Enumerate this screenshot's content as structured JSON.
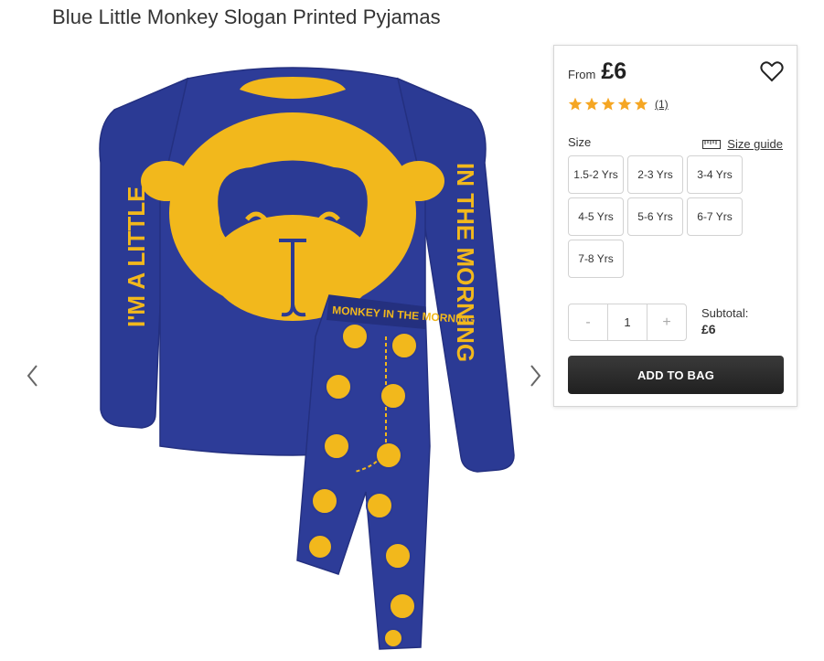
{
  "product": {
    "title": "Blue Little Monkey Slogan Printed Pyjamas",
    "from_label": "From",
    "price": "£6",
    "rating": {
      "stars": 5,
      "count": "(1)"
    },
    "size_label": "Size",
    "size_guide_label": "Size guide",
    "sizes": [
      "1.5-2 Yrs",
      "2-3 Yrs",
      "3-4 Yrs",
      "4-5 Yrs",
      "5-6 Yrs",
      "6-7 Yrs",
      "7-8 Yrs"
    ],
    "quantity": {
      "minus": "-",
      "value": "1",
      "plus": "+"
    },
    "subtotal_label": "Subtotal:",
    "subtotal_value": "£6",
    "add_to_bag": "ADD TO BAG"
  },
  "image_text": {
    "sleeve_left": "I'M A LITTLE",
    "sleeve_right": "IN THE MORNING",
    "waistband": "MONKEY IN THE MORNING"
  },
  "colors": {
    "navy": "#2b3a94",
    "yellow": "#f2b81c",
    "star": "#f5a623",
    "button_dark": "#2a2a2a"
  },
  "icons": {
    "heart": "heart-icon",
    "ruler": "ruler-icon",
    "prev": "chevron-left-icon",
    "next": "chevron-right-icon"
  }
}
